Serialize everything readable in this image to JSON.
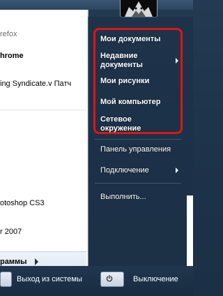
{
  "left_panel": {
    "programs": [
      {
        "label": "refox",
        "dim": true
      },
      {
        "label": "hrome",
        "bold": true
      },
      {
        "label": "ing Syndicate.v Патч"
      },
      {
        "label": "otoshop CS3"
      },
      {
        "label": "r 2007"
      }
    ],
    "all_programs_label": "раммы"
  },
  "right_panel": {
    "items": [
      {
        "label": "Мои документы"
      },
      {
        "label": "Недавние документы",
        "line1": "Недавние",
        "line2": "документы"
      },
      {
        "label": "Мои рисунки"
      },
      {
        "label": "Мой компьютер"
      },
      {
        "label": "Сетевое окружение",
        "line1": "Сетевое",
        "line2": "окружение"
      }
    ],
    "control_panel_label": "Панель управления",
    "connect_label": "Подключение",
    "run_label": "Выполнить..."
  },
  "footer": {
    "logoff_label": "Выход из системы",
    "shutdown_label": "Выключение"
  },
  "colors": {
    "highlight_border": "#e01414",
    "panel_text": "#ffffff"
  },
  "icons": {
    "submenu_arrow": "chevron-right-icon",
    "power": "power-icon",
    "user_picture": "avatar"
  }
}
